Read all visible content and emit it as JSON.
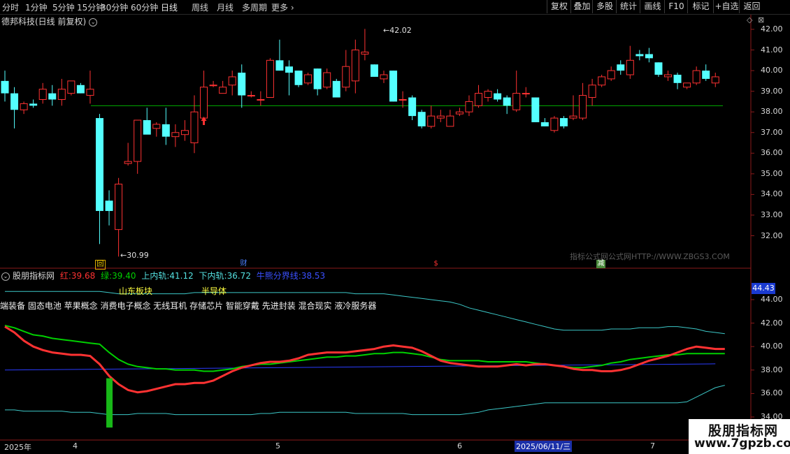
{
  "period_tabs": [
    "分时",
    "1分钟",
    "5分钟",
    "15分钟",
    "30分钟",
    "60分钟",
    "日线",
    "周线",
    "月线",
    "多周期",
    "更多"
  ],
  "active_period": "日线",
  "toolbar": [
    "复权",
    "叠加",
    "多股",
    "统计",
    "画线",
    "F10",
    "标记",
    "+自选",
    "返回"
  ],
  "stock": {
    "title": "德邦科技(日线 前复权)"
  },
  "price_axis": {
    "ticks": [
      "42.00",
      "41.00",
      "40.00",
      "39.00",
      "38.00",
      "37.00",
      "36.00",
      "35.00",
      "34.00",
      "33.00",
      "32.00"
    ]
  },
  "annotations": {
    "high": "42.02",
    "low": "30.99"
  },
  "event_markers": {
    "hui": "回",
    "cai": "财",
    "s": "$",
    "jian": "减"
  },
  "watermark": "指标公式网公式网HTTP://WWW.ZBGS3.COM",
  "indicator": {
    "name": "股朋指标网",
    "red_label": "红:",
    "red_value": "39.68",
    "green_label": "绿:",
    "green_value": "39.40",
    "upper_label": "上内轨:",
    "upper_value": "41.12",
    "lower_label": "下内轨:",
    "lower_value": "36.72",
    "mid_label": "牛熊分界线:",
    "mid_value": "38.53",
    "current_value": "44.43",
    "axis_ticks": [
      "44.00",
      "42.00",
      "40.00",
      "38.00",
      "36.00",
      "34.00"
    ]
  },
  "sectors": {
    "a": "山东板块",
    "b": "半导体"
  },
  "concepts": "端装备 固态电池 苹果概念 消费电子概念 无线耳机 存储芯片 智能穿戴 先进封装 混合现实 液冷服务器",
  "date_axis": {
    "year": "2025年",
    "m4": "4",
    "m5": "5",
    "m6": "6",
    "cursor": "2025/06/11/三",
    "m7": "7"
  },
  "logo": {
    "line1": "股朋指标网",
    "line2": "www.7gpzb.com"
  },
  "colors": {
    "up": "#ff3232",
    "down": "#54ffff",
    "green_line": "#00d000",
    "blue_line": "#2a3cff",
    "cyan_band": "#3cc8c8",
    "hline": "#00b000"
  },
  "chart_data": {
    "type": "candlestick",
    "price_range": [
      31.0,
      42.5
    ],
    "support_line": 38.3,
    "candles": [
      {
        "o": 39.5,
        "h": 40.0,
        "l": 38.5,
        "c": 38.9
      },
      {
        "o": 38.9,
        "h": 39.2,
        "l": 37.2,
        "c": 38.1
      },
      {
        "o": 38.1,
        "h": 38.5,
        "l": 37.9,
        "c": 38.4
      },
      {
        "o": 38.4,
        "h": 38.6,
        "l": 38.2,
        "c": 38.3
      },
      {
        "o": 38.6,
        "h": 39.4,
        "l": 38.4,
        "c": 39.1
      },
      {
        "o": 38.9,
        "h": 39.3,
        "l": 38.3,
        "c": 38.6
      },
      {
        "o": 38.6,
        "h": 39.6,
        "l": 38.3,
        "c": 39.1
      },
      {
        "o": 38.9,
        "h": 39.5,
        "l": 38.8,
        "c": 39.5
      },
      {
        "o": 39.3,
        "h": 39.4,
        "l": 38.9,
        "c": 38.9
      },
      {
        "o": 38.8,
        "h": 40.0,
        "l": 38.4,
        "c": 39.1
      },
      {
        "o": 37.7,
        "h": 37.9,
        "l": 31.6,
        "c": 33.2
      },
      {
        "o": 33.7,
        "h": 34.2,
        "l": 32.5,
        "c": 33.2
      },
      {
        "o": 32.3,
        "h": 34.8,
        "l": 30.99,
        "c": 34.5
      },
      {
        "o": 35.5,
        "h": 36.5,
        "l": 35.4,
        "c": 35.6
      },
      {
        "o": 35.6,
        "h": 37.6,
        "l": 35.0,
        "c": 37.6
      },
      {
        "o": 37.6,
        "h": 38.2,
        "l": 37.0,
        "c": 36.9
      },
      {
        "o": 37.2,
        "h": 37.5,
        "l": 36.8,
        "c": 37.4
      },
      {
        "o": 37.4,
        "h": 38.2,
        "l": 36.4,
        "c": 36.8
      },
      {
        "o": 36.8,
        "h": 37.4,
        "l": 36.3,
        "c": 37.0
      },
      {
        "o": 36.9,
        "h": 37.6,
        "l": 36.6,
        "c": 37.1
      },
      {
        "o": 36.5,
        "h": 38.8,
        "l": 36.0,
        "c": 38.0
      },
      {
        "o": 37.7,
        "h": 40.0,
        "l": 37.6,
        "c": 39.2
      },
      {
        "o": 39.3,
        "h": 39.5,
        "l": 39.2,
        "c": 39.3
      },
      {
        "o": 38.9,
        "h": 39.5,
        "l": 38.9,
        "c": 39.2
      },
      {
        "o": 39.3,
        "h": 40.0,
        "l": 38.8,
        "c": 39.7
      },
      {
        "o": 39.9,
        "h": 40.3,
        "l": 38.2,
        "c": 38.8
      },
      {
        "o": 38.8,
        "h": 39.0,
        "l": 38.7,
        "c": 38.8
      },
      {
        "o": 38.6,
        "h": 39.0,
        "l": 38.3,
        "c": 38.6
      },
      {
        "o": 38.7,
        "h": 40.6,
        "l": 38.7,
        "c": 40.5
      },
      {
        "o": 40.5,
        "h": 41.5,
        "l": 40.0,
        "c": 40.0
      },
      {
        "o": 40.2,
        "h": 40.5,
        "l": 38.8,
        "c": 39.9
      },
      {
        "o": 40.0,
        "h": 40.0,
        "l": 39.2,
        "c": 39.3
      },
      {
        "o": 39.4,
        "h": 39.9,
        "l": 39.3,
        "c": 39.8
      },
      {
        "o": 40.1,
        "h": 40.1,
        "l": 38.8,
        "c": 39.1
      },
      {
        "o": 39.2,
        "h": 40.1,
        "l": 39.1,
        "c": 39.9
      },
      {
        "o": 39.5,
        "h": 39.6,
        "l": 38.7,
        "c": 38.7
      },
      {
        "o": 39.2,
        "h": 41.0,
        "l": 39.0,
        "c": 40.2
      },
      {
        "o": 39.5,
        "h": 41.5,
        "l": 38.9,
        "c": 41.0
      },
      {
        "o": 40.8,
        "h": 42.02,
        "l": 40.5,
        "c": 40.9
      },
      {
        "o": 40.3,
        "h": 40.3,
        "l": 39.7,
        "c": 39.7
      },
      {
        "o": 39.6,
        "h": 40.0,
        "l": 39.4,
        "c": 39.8
      },
      {
        "o": 40.0,
        "h": 40.0,
        "l": 38.5,
        "c": 38.5
      },
      {
        "o": 38.6,
        "h": 39.0,
        "l": 38.2,
        "c": 38.6
      },
      {
        "o": 38.7,
        "h": 38.8,
        "l": 37.6,
        "c": 37.8
      },
      {
        "o": 38.0,
        "h": 38.1,
        "l": 37.2,
        "c": 37.3
      },
      {
        "o": 37.3,
        "h": 38.3,
        "l": 37.2,
        "c": 37.8
      },
      {
        "o": 37.7,
        "h": 38.1,
        "l": 37.5,
        "c": 37.8
      },
      {
        "o": 37.3,
        "h": 38.1,
        "l": 37.3,
        "c": 37.8
      },
      {
        "o": 37.9,
        "h": 38.2,
        "l": 37.8,
        "c": 38.0
      },
      {
        "o": 38.0,
        "h": 38.8,
        "l": 37.8,
        "c": 38.5
      },
      {
        "o": 38.3,
        "h": 39.3,
        "l": 38.2,
        "c": 38.9
      },
      {
        "o": 38.7,
        "h": 39.1,
        "l": 38.5,
        "c": 39.0
      },
      {
        "o": 38.9,
        "h": 39.1,
        "l": 38.5,
        "c": 38.6
      },
      {
        "o": 38.7,
        "h": 38.8,
        "l": 37.9,
        "c": 38.3
      },
      {
        "o": 38.1,
        "h": 40.0,
        "l": 38.0,
        "c": 38.9
      },
      {
        "o": 38.9,
        "h": 39.2,
        "l": 38.7,
        "c": 38.9
      },
      {
        "o": 38.7,
        "h": 38.7,
        "l": 37.5,
        "c": 37.5
      },
      {
        "o": 37.5,
        "h": 37.7,
        "l": 37.3,
        "c": 37.3
      },
      {
        "o": 37.1,
        "h": 37.8,
        "l": 37.0,
        "c": 37.7
      },
      {
        "o": 37.7,
        "h": 37.8,
        "l": 37.2,
        "c": 37.3
      },
      {
        "o": 37.7,
        "h": 38.8,
        "l": 37.6,
        "c": 37.8
      },
      {
        "o": 37.7,
        "h": 39.4,
        "l": 37.6,
        "c": 38.8
      },
      {
        "o": 38.7,
        "h": 39.6,
        "l": 38.3,
        "c": 39.3
      },
      {
        "o": 39.3,
        "h": 39.8,
        "l": 39.2,
        "c": 39.7
      },
      {
        "o": 39.6,
        "h": 40.2,
        "l": 39.5,
        "c": 40.0
      },
      {
        "o": 40.3,
        "h": 40.5,
        "l": 39.8,
        "c": 40.0
      },
      {
        "o": 39.8,
        "h": 41.2,
        "l": 39.6,
        "c": 40.5
      },
      {
        "o": 40.8,
        "h": 41.0,
        "l": 40.5,
        "c": 40.7
      },
      {
        "o": 40.8,
        "h": 41.1,
        "l": 40.4,
        "c": 40.6
      },
      {
        "o": 40.4,
        "h": 40.4,
        "l": 39.7,
        "c": 39.8
      },
      {
        "o": 39.7,
        "h": 40.0,
        "l": 39.5,
        "c": 39.8
      },
      {
        "o": 39.8,
        "h": 39.9,
        "l": 39.1,
        "c": 39.4
      },
      {
        "o": 39.2,
        "h": 39.4,
        "l": 39.1,
        "c": 39.4
      },
      {
        "o": 39.4,
        "h": 40.2,
        "l": 39.3,
        "c": 40.0
      },
      {
        "o": 40.0,
        "h": 40.3,
        "l": 39.5,
        "c": 39.6
      },
      {
        "o": 39.4,
        "h": 39.9,
        "l": 39.2,
        "c": 39.7
      }
    ],
    "indicator_range": [
      34.0,
      45.2
    ],
    "red_line": [
      41.7,
      41.2,
      40.5,
      40.0,
      39.7,
      39.5,
      39.4,
      39.3,
      39.3,
      39.2,
      38.5,
      37.5,
      36.8,
      36.3,
      36.1,
      36.2,
      36.4,
      36.6,
      36.8,
      36.8,
      36.9,
      36.9,
      37.1,
      37.5,
      37.9,
      38.2,
      38.4,
      38.6,
      38.7,
      38.7,
      38.8,
      39.0,
      39.3,
      39.4,
      39.5,
      39.5,
      39.5,
      39.6,
      39.7,
      39.8,
      40.0,
      40.1,
      40.0,
      39.9,
      39.6,
      39.2,
      38.8,
      38.6,
      38.5,
      38.4,
      38.3,
      38.3,
      38.3,
      38.4,
      38.5,
      38.4,
      38.5,
      38.5,
      38.4,
      38.3,
      38.1,
      38.0,
      38.0,
      37.9,
      37.9,
      38.0,
      38.2,
      38.5,
      38.8,
      39.0,
      39.2,
      39.5,
      39.8,
      40.0,
      39.9,
      39.8,
      39.8
    ],
    "green_line": [
      41.8,
      41.6,
      41.3,
      41.0,
      40.9,
      40.7,
      40.6,
      40.5,
      40.4,
      40.3,
      40.2,
      39.5,
      38.9,
      38.5,
      38.3,
      38.2,
      38.1,
      38.1,
      38.0,
      38.0,
      38.0,
      37.9,
      37.9,
      38.0,
      38.1,
      38.3,
      38.4,
      38.5,
      38.5,
      38.6,
      38.7,
      38.8,
      38.9,
      39.0,
      39.1,
      39.1,
      39.2,
      39.2,
      39.3,
      39.4,
      39.4,
      39.5,
      39.5,
      39.4,
      39.3,
      39.1,
      38.9,
      38.8,
      38.8,
      38.8,
      38.8,
      38.7,
      38.7,
      38.7,
      38.7,
      38.7,
      38.6,
      38.5,
      38.4,
      38.3,
      38.2,
      38.2,
      38.3,
      38.4,
      38.6,
      38.7,
      38.9,
      39.0,
      39.1,
      39.2,
      39.3,
      39.3,
      39.4,
      39.4,
      39.4,
      39.4,
      39.4
    ],
    "upper_band": [
      44.7,
      44.7,
      44.7,
      44.7,
      44.7,
      44.7,
      44.7,
      44.7,
      44.7,
      44.7,
      44.7,
      44.6,
      44.5,
      44.5,
      44.5,
      44.5,
      44.5,
      44.5,
      44.5,
      44.5,
      44.6,
      44.6,
      44.6,
      44.6,
      44.6,
      44.6,
      44.6,
      44.6,
      44.6,
      44.6,
      44.6,
      44.6,
      44.6,
      44.6,
      44.6,
      44.6,
      44.6,
      44.5,
      44.5,
      44.5,
      44.5,
      44.4,
      44.3,
      44.2,
      44.1,
      44.0,
      43.9,
      43.8,
      43.6,
      43.3,
      43.1,
      42.9,
      42.7,
      42.5,
      42.3,
      42.1,
      41.9,
      41.7,
      41.5,
      41.4,
      41.4,
      41.4,
      41.4,
      41.4,
      41.5,
      41.5,
      41.5,
      41.6,
      41.6,
      41.6,
      41.7,
      41.7,
      41.6,
      41.5,
      41.3,
      41.2,
      41.1
    ],
    "lower_band": [
      34.6,
      34.6,
      34.5,
      34.5,
      34.5,
      34.5,
      34.5,
      34.4,
      34.4,
      34.4,
      34.3,
      34.2,
      34.2,
      34.2,
      34.3,
      34.3,
      34.3,
      34.3,
      34.2,
      34.2,
      34.2,
      34.2,
      34.2,
      34.2,
      34.2,
      34.2,
      34.2,
      34.3,
      34.3,
      34.4,
      34.4,
      34.4,
      34.4,
      34.4,
      34.4,
      34.4,
      34.4,
      34.3,
      34.3,
      34.3,
      34.3,
      34.3,
      34.3,
      34.2,
      34.2,
      34.2,
      34.2,
      34.2,
      34.2,
      34.3,
      34.4,
      34.6,
      34.7,
      34.8,
      34.9,
      35.0,
      35.1,
      35.2,
      35.2,
      35.2,
      35.2,
      35.2,
      35.2,
      35.2,
      35.2,
      35.2,
      35.2,
      35.2,
      35.2,
      35.2,
      35.2,
      35.2,
      35.3,
      35.7,
      36.1,
      36.5,
      36.7
    ],
    "mid_line_start": 38.0,
    "mid_line_end": 38.53,
    "signal_bar": {
      "index": 11,
      "top": 37.3,
      "bottom": 33.1
    }
  }
}
